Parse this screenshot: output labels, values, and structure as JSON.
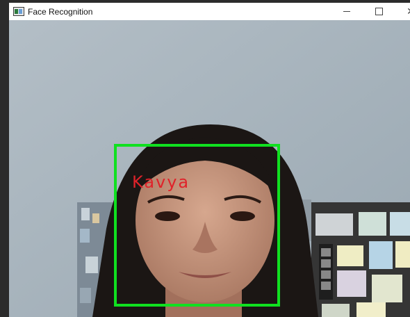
{
  "window": {
    "title": "Face Recognition"
  },
  "icons": {
    "app": "app-window-icon",
    "minimize": "minimize-icon",
    "maximize": "maximize-icon",
    "close": "close-icon"
  },
  "detection": {
    "label": "Kavya",
    "box_color": "#10e020",
    "label_color": "#e0222a"
  }
}
